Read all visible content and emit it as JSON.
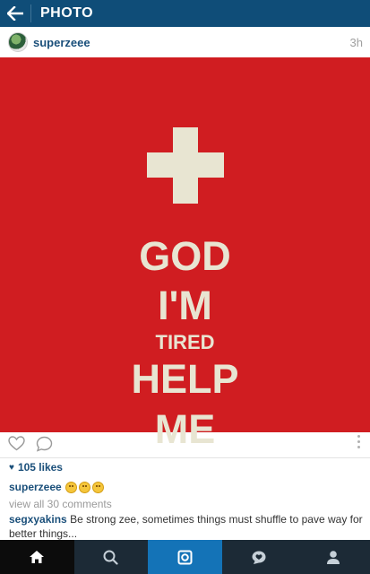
{
  "header": {
    "title": "PHOTO",
    "back_icon": "arrow-left-icon",
    "bg": "#0f4d78"
  },
  "post": {
    "username": "superzeee",
    "time": "3h",
    "image": {
      "background": "#d01d21",
      "text_color": "#e8e5d2",
      "lines": [
        "GOD",
        "I'M",
        "TIRED",
        "HELP",
        "ME"
      ]
    },
    "likes": "105 likes",
    "caption_user": "superzeee",
    "view_all": "view all 30 comments",
    "comment": {
      "user": "segxyakins",
      "text": "Be strong zee, sometimes things must shuffle to pave way for better things..."
    }
  },
  "nav": {
    "tabs": [
      "home-icon",
      "search-icon",
      "camera-icon",
      "activity-icon",
      "profile-icon"
    ],
    "active": "home-icon"
  }
}
